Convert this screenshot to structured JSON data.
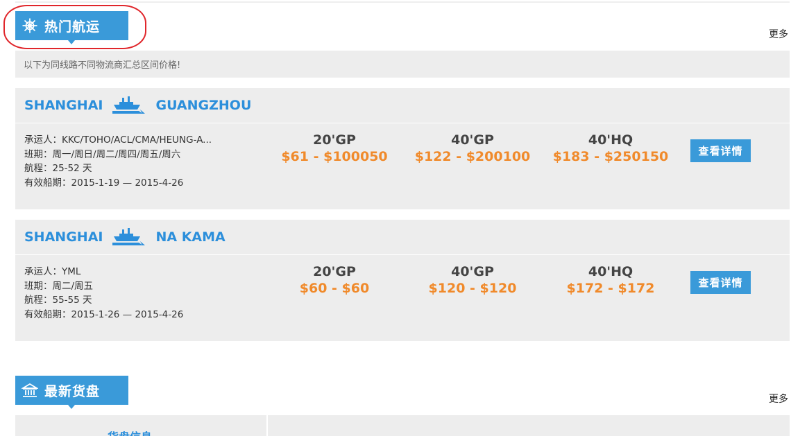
{
  "hot_shipping": {
    "title": "热门航运",
    "icon": "ship-wheel-icon",
    "more_label": "更多",
    "subtitle": "以下为同线路不同物流商汇总区间价格!"
  },
  "routes": [
    {
      "origin": "SHANGHAI",
      "destination": "GUANGZHOU",
      "carrier": "承运人：KKC/TOHO/ACL/CMA/HEUNG-A...",
      "schedule": "班期：周一/周日/周二/周四/周五/周六",
      "voyage": "航程：25-52 天",
      "validity": "有效船期：2015-1-19 — 2015-4-26",
      "prices": [
        {
          "container": "20'GP",
          "range": "$61 - $100050"
        },
        {
          "container": "40'GP",
          "range": "$122 - $200100"
        },
        {
          "container": "40'HQ",
          "range": "$183 - $250150"
        }
      ],
      "detail_label": "查看详情"
    },
    {
      "origin": "SHANGHAI",
      "destination": "NA KAMA",
      "carrier": "承运人：YML",
      "schedule": "班期：周二/周五",
      "voyage": "航程：55-55 天",
      "validity": "有效船期：2015-1-26 — 2015-4-26",
      "prices": [
        {
          "container": "20'GP",
          "range": "$60 - $60"
        },
        {
          "container": "40'GP",
          "range": "$120 - $120"
        },
        {
          "container": "40'HQ",
          "range": "$172 - $172"
        }
      ],
      "detail_label": "查看详情"
    }
  ],
  "latest_cargo": {
    "title": "最新货盘",
    "icon": "bank-icon",
    "more_label": "更多",
    "column_header": "货盘信息"
  },
  "colors": {
    "accent": "#3a9ad9",
    "route_text": "#2c8fdb",
    "price": "#f08a2b",
    "highlight_oval": "#e0262b"
  }
}
